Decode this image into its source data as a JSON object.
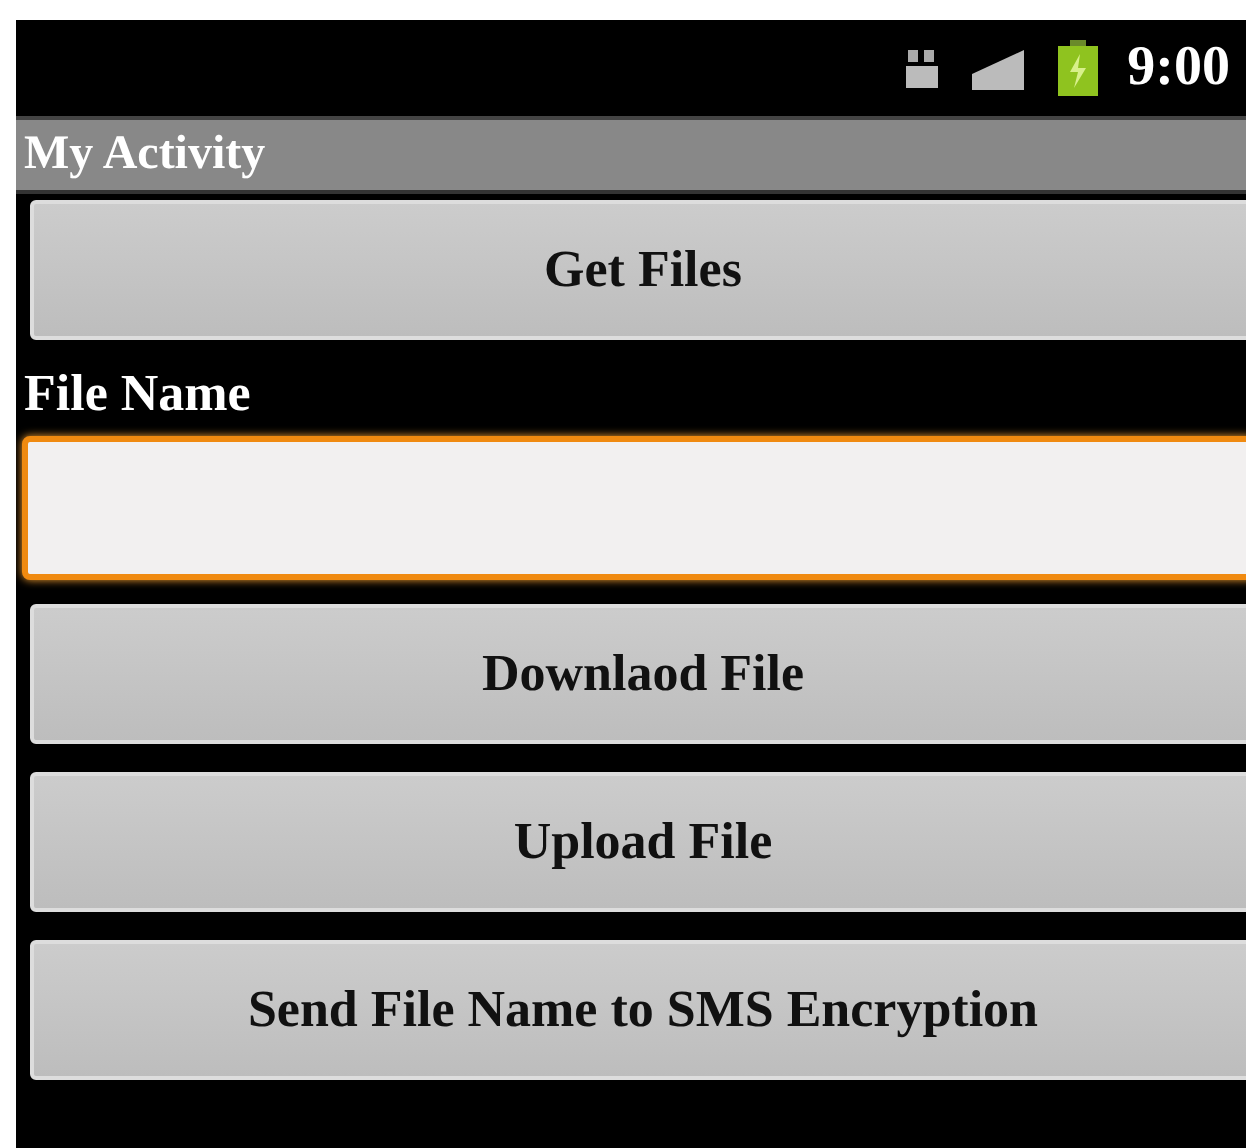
{
  "status_bar": {
    "time": "9:00"
  },
  "window": {
    "title": "My Activity"
  },
  "content": [
    {
      "kind": "button",
      "label": "Get Files"
    },
    {
      "kind": "label",
      "label": "File Name"
    },
    {
      "kind": "field",
      "focused": true
    },
    {
      "kind": "button",
      "label": "Downlaod File"
    },
    {
      "kind": "button",
      "label": "Upload File"
    },
    {
      "kind": "button",
      "label": "Send File Name to SMS Encryption"
    }
  ]
}
